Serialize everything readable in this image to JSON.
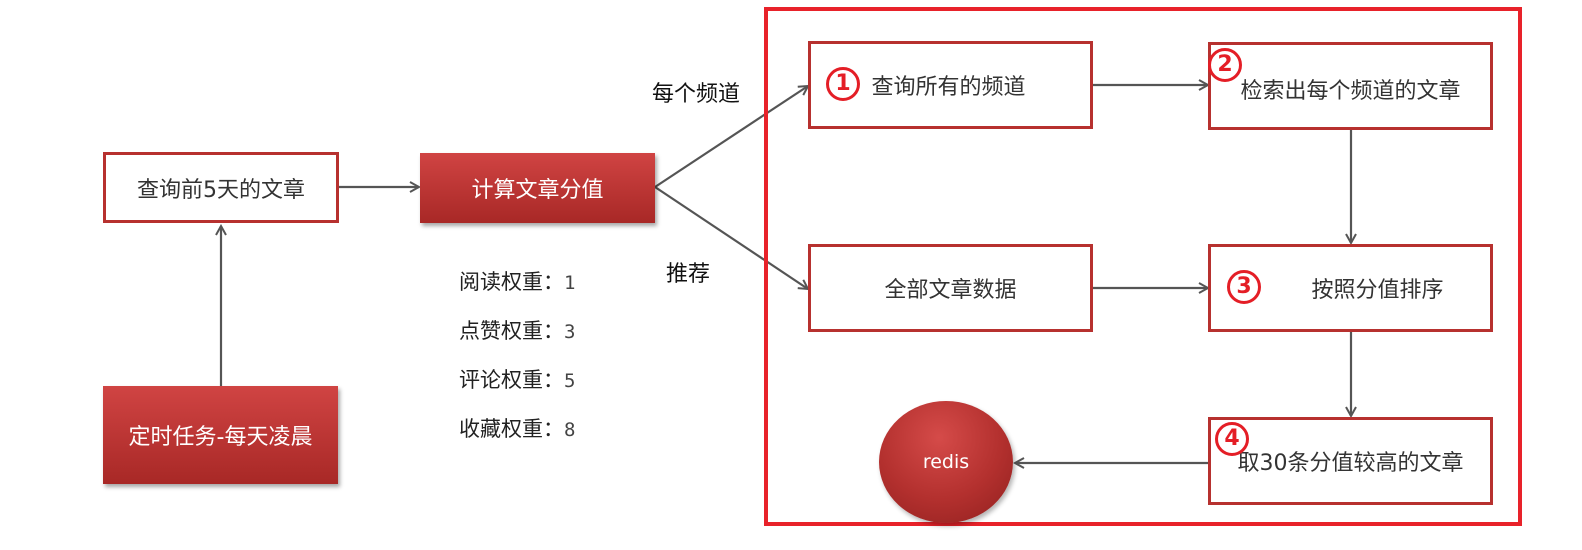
{
  "nodes": {
    "query_recent": "查询前5天的文章",
    "daily_job": "定时任务-每天凌晨",
    "compute_score": "计算文章分值",
    "query_channels": "查询所有的频道",
    "search_channel_articles": "检索出每个频道的文章",
    "all_articles": "全部文章数据",
    "sort_by_score": "按照分值排序",
    "top_30": "取30条分值较高的文章",
    "redis": "redis"
  },
  "edge_labels": {
    "per_channel": "每个频道",
    "recommend": "推荐"
  },
  "steps": [
    "1",
    "2",
    "3",
    "4"
  ],
  "weights": [
    {
      "label": "阅读权重：",
      "value": "1"
    },
    {
      "label": "点赞权重：",
      "value": "3"
    },
    {
      "label": "评论权重：",
      "value": "5"
    },
    {
      "label": "收藏权重：",
      "value": "8"
    }
  ],
  "colors": {
    "accent_red": "#e41e26",
    "box_border": "#b7312f",
    "fill_red": "#c13836",
    "arrow": "#555555"
  }
}
